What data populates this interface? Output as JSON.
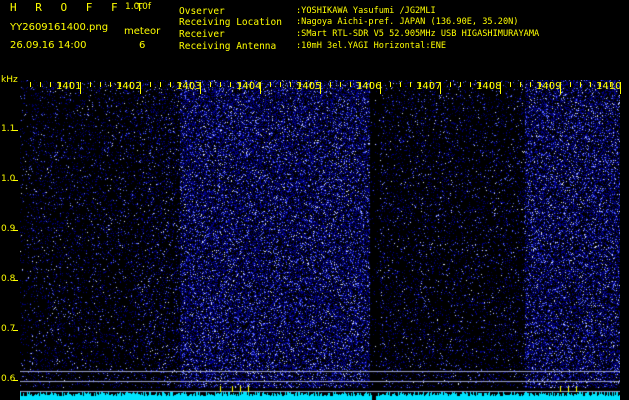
{
  "header": {
    "brand": "H R O F F T",
    "version": "1.0.0f",
    "filename": "YY2609161400.png",
    "meteor_label": "meteor",
    "datetime": "26.09.16 14:00",
    "meteor_count": "6"
  },
  "station_info": [
    {
      "label": "Ovserver",
      "value": ":YOSHIKAWA Yasufumi /JG2MLI"
    },
    {
      "label": "Receiving Location",
      "value": ":Nagoya Aichi-pref. JAPAN (136.90E, 35.20N)"
    },
    {
      "label": "Receiver",
      "value": ":SMart RTL-SDR V5 52.905MHz USB HIGASHIMURAYAMA"
    },
    {
      "label": "Receiving Antenna",
      "value": ":10mH 3el.YAGI Horizontal:ENE"
    }
  ],
  "spectrogram": {
    "unit_label": "kHz",
    "y_ticks": [
      "1.1",
      "1.0",
      "0.9",
      "0.8",
      "0.7",
      "0.6"
    ],
    "time_labels": [
      "1401",
      "1402",
      "1403",
      "1404",
      "1405",
      "1406",
      "1407",
      "1408",
      "1409",
      "1410"
    ],
    "colors": {
      "background": "#000000",
      "noise_floor": "#00008a",
      "noise_speck": "#5a6cff",
      "noise_bright": "#dde4ff",
      "baseline_band": "#00e5ff",
      "axis_text": "#ffff00",
      "info_text": "#ffff00"
    }
  }
}
